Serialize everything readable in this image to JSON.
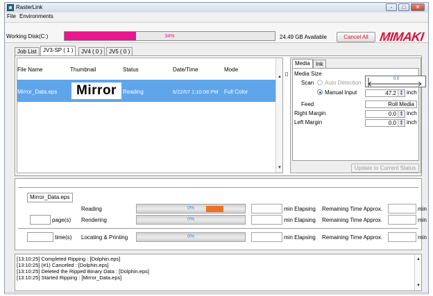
{
  "window": {
    "title": "RasterLink",
    "controls": {
      "minimize": "-",
      "maximize": "□",
      "close": "✕"
    }
  },
  "menu": {
    "items": [
      "File",
      "Environments"
    ]
  },
  "disk": {
    "label": "Working Disk(C:)",
    "usage_percent": 34,
    "usage_text": "34%",
    "available": "24.49 GB Available",
    "cancel_all": "Cancel All",
    "accent_color": "#e8168f"
  },
  "brand": {
    "logo_text": "MIMAKI",
    "logo_color": "#d4143d"
  },
  "tabs": [
    "Job List",
    "JV3-SP ( 1 )",
    "JV4 ( 0 )",
    "JV5 ( 0 )"
  ],
  "job_list": {
    "columns": [
      "File Name",
      "Thumbnail",
      "Status",
      "Date/Time",
      "Mode"
    ],
    "rows": [
      {
        "file_name": "Mirror_Data.eps",
        "thumbnail_text": "Mirror",
        "status": "Reading",
        "datetime": "6/22/07 1:10:08 PM",
        "mode": "Full Color"
      }
    ],
    "selected_color": "#5fa5ea"
  },
  "media": {
    "tabs": [
      "Media",
      "Ink"
    ],
    "size_label": "Media Size",
    "scan_label": "Scan",
    "auto_detection": "Auto Detection",
    "manual_input": "Manual Input",
    "gauge_value": "0.0",
    "scan_value": "47.2",
    "feed_label": "Feed",
    "feed_value": "Roll Media",
    "right_margin_label": "Right Margin",
    "right_margin_value": "0.0",
    "left_margin_label": "Left Margin",
    "left_margin_value": "0.0",
    "unit": "inch",
    "update_button": "Update to Current Status"
  },
  "progress": {
    "file_name": "Mirror_Data.eps",
    "page_label": "page(s)",
    "time_label": "time(s)",
    "rows": [
      {
        "label": "Reading",
        "percent": 0,
        "percent_text": "0%",
        "elapsing": "min Elapsing",
        "remaining": "Remaining Time Approx.",
        "min": "min"
      },
      {
        "label": "Rendering",
        "percent": 0,
        "percent_text": "0%",
        "elapsing": "min Elapsing",
        "remaining": "Remaining Time Approx.",
        "min": "min"
      },
      {
        "label": "Locating & Printing",
        "percent": 0,
        "percent_text": "0%",
        "elapsing": "min Elapsing",
        "remaining": "Remaining Time Approx.",
        "min": "min"
      }
    ],
    "busy_indicator_color": "#f07124"
  },
  "log": {
    "lines": [
      "[13:10:25] Completed Ripping : [Dolphin.eps]",
      "[13:10:25] (#1) Canceled : [Dolphin.eps]",
      "[13:10:25] Deleted the Ripped Binary Data : [Dolphin.eps]",
      "[13:10:25] Started Ripping : [Mirror_Data.eps]"
    ]
  }
}
